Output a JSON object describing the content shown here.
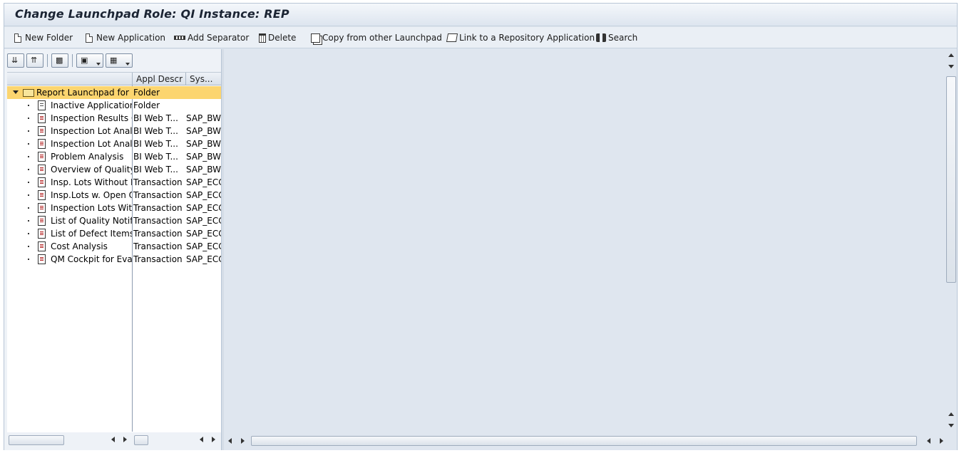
{
  "window": {
    "title": "Change Launchpad Role: QI Instance: REP"
  },
  "toolbar": {
    "new_folder": "New Folder",
    "new_application": "New Application",
    "add_separator": "Add Separator",
    "delete": "Delete",
    "copy_from_other_launchpad": "Copy from other Launchpad",
    "link_to_repository_application": "Link to a Repository Application",
    "search": "Search"
  },
  "tree": {
    "columns": [
      "Appl Descr",
      "Sys..."
    ],
    "root": {
      "label": "Report Launchpad for Q",
      "type": "Folder",
      "sys": ""
    },
    "items": [
      {
        "label": "Inactive Applications",
        "type": "Folder",
        "sys": "",
        "icon": "table-icon"
      },
      {
        "label": "Inspection Results O",
        "type": "BI Web T...",
        "sys": "SAP_BW",
        "icon": "report-icon"
      },
      {
        "label": "Inspection Lot Analy",
        "type": "BI Web T...",
        "sys": "SAP_BW",
        "icon": "report-icon"
      },
      {
        "label": "Inspection Lot Analy",
        "type": "BI Web T...",
        "sys": "SAP_BW",
        "icon": "report-icon"
      },
      {
        "label": "Problem Analysis",
        "type": "BI Web T...",
        "sys": "SAP_BW",
        "icon": "report-icon"
      },
      {
        "label": "Overview of Quality I",
        "type": "BI Web T...",
        "sys": "SAP_BW",
        "icon": "report-icon"
      },
      {
        "label": "Insp. Lots Without I",
        "type": "Transaction",
        "sys": "SAP_ECC",
        "icon": "report-icon"
      },
      {
        "label": "Insp.Lots w. Open Q",
        "type": "Transaction",
        "sys": "SAP_ECC",
        "icon": "report-icon"
      },
      {
        "label": "Inspection Lots With",
        "type": "Transaction",
        "sys": "SAP_ECC",
        "icon": "report-icon"
      },
      {
        "label": "List of Quality Notific",
        "type": "Transaction",
        "sys": "SAP_ECC",
        "icon": "report-icon"
      },
      {
        "label": "List of Defect Items",
        "type": "Transaction",
        "sys": "SAP_ECC",
        "icon": "report-icon"
      },
      {
        "label": "Cost Analysis",
        "type": "Transaction",
        "sys": "SAP_ECC",
        "icon": "report-icon"
      },
      {
        "label": "QM Cockpit for Evalu",
        "type": "Transaction",
        "sys": "SAP_ECC",
        "icon": "report-icon"
      }
    ]
  },
  "colors": {
    "selection": "#fcd56f",
    "frame": "#dfe6ef",
    "title_text": "#1b2433"
  }
}
